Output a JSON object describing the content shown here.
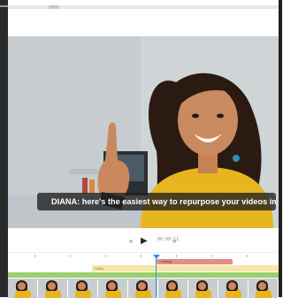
{
  "caption": {
    "text": "DIANA: here's the easiest way to repurpose your videos image"
  },
  "player": {
    "rewind_icon": "rewind-icon",
    "play_icon": "play-icon",
    "forward_icon": "fast-forward-icon",
    "timecode": "00:00:11"
  },
  "tracks": {
    "subtitle_label": "Writing",
    "text_label": "Video"
  },
  "colors": {
    "accent_blue": "#3a8de3",
    "subtitle_track": "#e58c83",
    "text_track": "#f3e6a6",
    "audio_track": "#9ccf6e",
    "shirt_yellow": "#e6b51f"
  },
  "thumbnails": [
    "frame",
    "frame",
    "frame",
    "frame",
    "frame",
    "frame",
    "frame",
    "frame",
    "frame"
  ]
}
